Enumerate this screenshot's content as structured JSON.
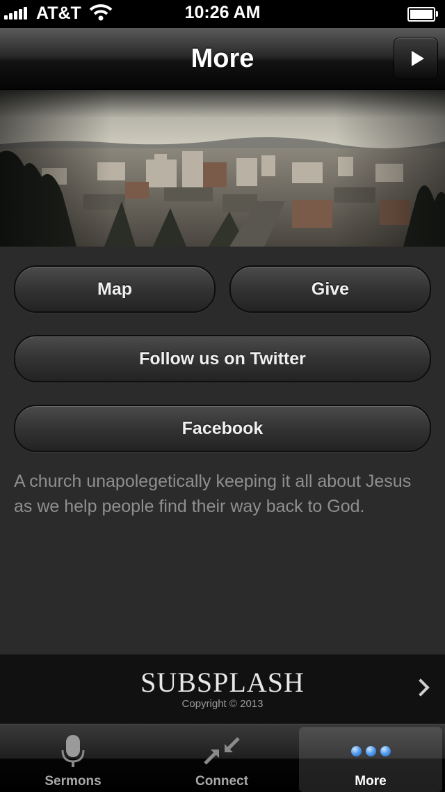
{
  "status_bar": {
    "carrier": "AT&T",
    "time": "10:26 AM"
  },
  "nav": {
    "title": "More"
  },
  "header": {
    "image_description": "city-skyline-photo"
  },
  "buttons": {
    "map": "Map",
    "give": "Give",
    "twitter": "Follow us on Twitter",
    "facebook": "Facebook"
  },
  "blurb": "A church unapolegetically keeping it all about Jesus as we help people find their way back to God.",
  "footer": {
    "brand": "SUBSPLASH",
    "copyright": "Copyright © 2013"
  },
  "tabs": [
    {
      "label": "Sermons",
      "icon": "microphone-icon",
      "active": false
    },
    {
      "label": "Connect",
      "icon": "connect-arrows-icon",
      "active": false
    },
    {
      "label": "More",
      "icon": "more-dots-icon",
      "active": true
    }
  ],
  "colors": {
    "background": "#2b2b2b",
    "blurb_text": "#8f8f8f",
    "active_tab_dots": "#5aa0f0"
  }
}
